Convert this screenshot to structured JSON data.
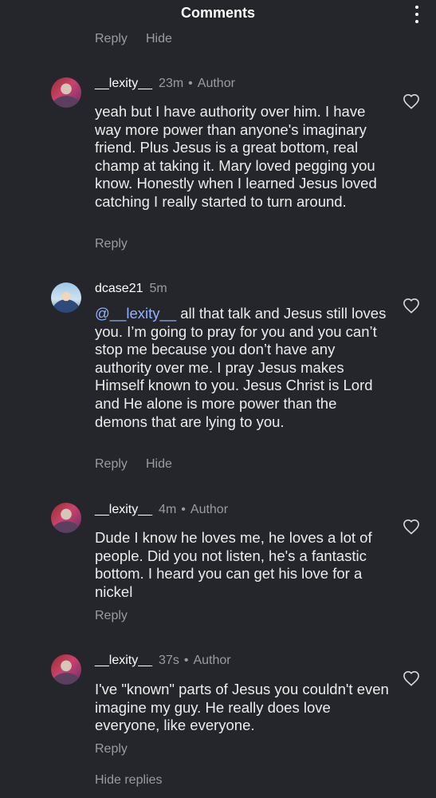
{
  "header": {
    "title": "Comments"
  },
  "top_actions": {
    "reply": "Reply",
    "hide": "Hide"
  },
  "comments": [
    {
      "username": "__lexity__",
      "time": "23m",
      "badge": "Author",
      "text": "yeah but I have authority over him. I have way more power than anyone's imaginary friend. Plus Jesus is a great bottom, real champ at taking it. Mary loved pegging you know. Honestly when I learned Jesus loved catching I really started to turn around.",
      "reply": "Reply"
    },
    {
      "username": "dcase21",
      "time": "5m",
      "mention": "@__lexity__",
      "text": " all that talk and Jesus still loves you. I’m going to pray for you and you can’t stop me because you don’t have any authority over me. I pray Jesus makes Himself known to you. Jesus Christ is Lord and He alone is more power than the demons that are lying to you.",
      "reply": "Reply",
      "hide": "Hide"
    },
    {
      "username": "__lexity__",
      "time": "4m",
      "badge": "Author",
      "text": "Dude I know he loves me, he loves a lot of people. Did you not listen, he's a fantastic bottom. I heard you can get his love for a nickel",
      "reply": "Reply"
    },
    {
      "username": "__lexity__",
      "time": "37s",
      "badge": "Author",
      "text": "I've \"known\" parts of Jesus you couldn't even imagine my guy. He really does love everyone, like everyone.",
      "reply": "Reply"
    }
  ],
  "footer": {
    "hide_replies": "Hide replies"
  },
  "icons": [
    "more-vertical-icon",
    "heart-outline-icon"
  ],
  "colors": {
    "background": "#25262b",
    "text": "#ececec",
    "muted": "#9a9ba0",
    "mention": "#8eb4ff"
  }
}
